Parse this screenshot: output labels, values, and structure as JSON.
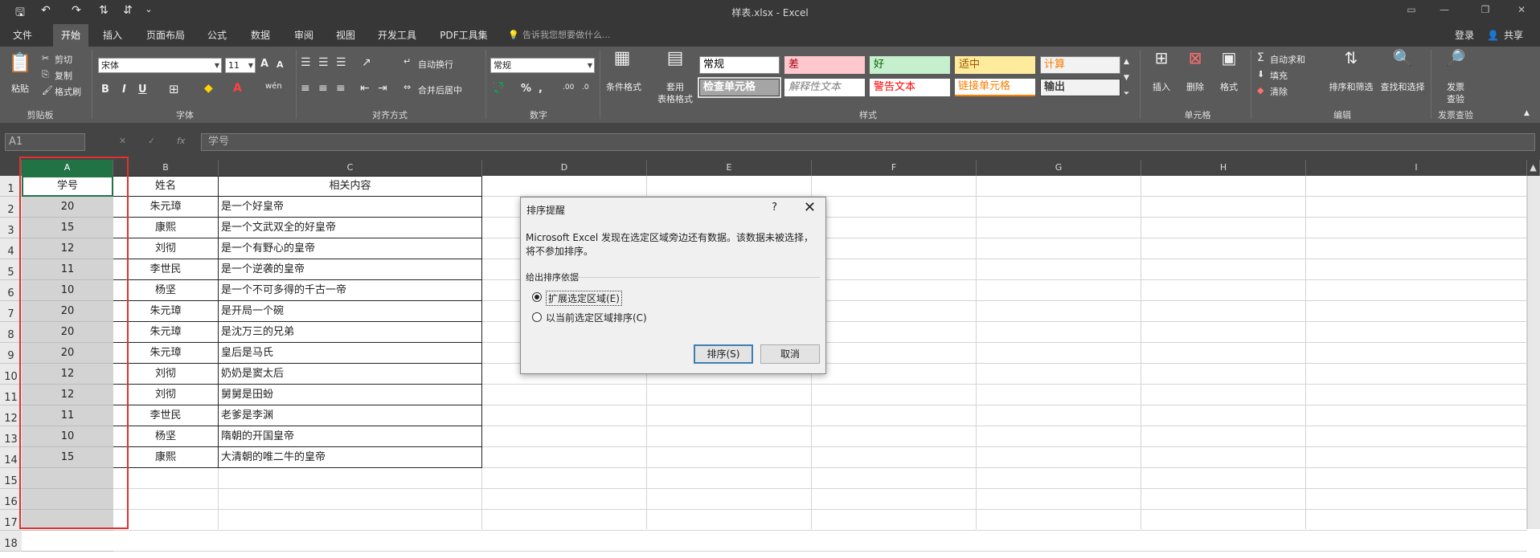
{
  "window": {
    "title": "样表.xlsx - Excel"
  },
  "quick_access": {
    "save": "🖫",
    "undo": "↶",
    "redo": "↷",
    "sort_asc": "⇅",
    "sort_desc": "⇵",
    "customize": "⌄"
  },
  "window_controls": {
    "restore_ribbon": "▭",
    "minimize": "—",
    "maximize": "❐",
    "close": "✕"
  },
  "menu": {
    "tabs": [
      "文件",
      "开始",
      "插入",
      "页面布局",
      "公式",
      "数据",
      "审阅",
      "视图",
      "开发工具",
      "PDF工具集"
    ],
    "active_index": 1,
    "tell_me": "告诉我您想要做什么...",
    "signin": "登录",
    "share": "共享"
  },
  "ribbon": {
    "clipboard": {
      "paste": "粘贴",
      "cut": "剪切",
      "copy": "复制",
      "format_painter": "格式刷",
      "label": "剪贴板"
    },
    "font": {
      "name": "宋体",
      "size": "11",
      "grow": "A",
      "shrink": "A",
      "bold": "B",
      "italic": "I",
      "underline": "U",
      "wen": "wén",
      "label": "字体"
    },
    "alignment": {
      "wrap": "自动换行",
      "merge": "合并后居中",
      "label": "对齐方式"
    },
    "number": {
      "format": "常规",
      "percent": "%",
      "comma": ",",
      "label": "数字"
    },
    "styles": {
      "conditional": "条件格式",
      "table_format": [
        "套用",
        "表格格式"
      ],
      "cells": [
        {
          "text": "常规",
          "bg": "#ffffff",
          "fg": "#000000",
          "border": "#888888"
        },
        {
          "text": "差",
          "bg": "#ffc7ce",
          "fg": "#9c0006",
          "border": "#ffc7ce"
        },
        {
          "text": "好",
          "bg": "#c6efce",
          "fg": "#006100",
          "border": "#c6efce"
        },
        {
          "text": "适中",
          "bg": "#ffeb9c",
          "fg": "#9c5700",
          "border": "#ffeb9c"
        },
        {
          "text": "计算",
          "bg": "#f2f2f2",
          "fg": "#fa7d00",
          "border": "#7f7f7f"
        },
        {
          "text": "检查单元格",
          "bg": "#a5a5a5",
          "fg": "#ffffff",
          "border": "#3f3f3f"
        },
        {
          "text": "解释性文本",
          "bg": "#ffffff",
          "fg": "#7f7f7f",
          "border": "#ffffff"
        },
        {
          "text": "警告文本",
          "bg": "#ffffff",
          "fg": "#ff0000",
          "border": "#ffffff"
        },
        {
          "text": "链接单元格",
          "bg": "#ffffff",
          "fg": "#fa7d00",
          "border": "#ff8001"
        },
        {
          "text": "输出",
          "bg": "#f2f2f2",
          "fg": "#3f3f3f",
          "border": "#3f3f3f"
        }
      ],
      "label": "样式"
    },
    "cells_group": {
      "insert": "插入",
      "delete": "删除",
      "format": "格式",
      "label": "单元格"
    },
    "editing": {
      "autosum": "自动求和",
      "fill": "填充",
      "clear": "清除",
      "sort_filter": "排序和筛选",
      "find_select": "查找和选择",
      "label": "编辑"
    },
    "invoice": {
      "btn": [
        "发票",
        "查验"
      ],
      "label": "发票查验"
    }
  },
  "formula_bar": {
    "name_box": "A1",
    "cancel": "✕",
    "enter": "✓",
    "fx": "fx",
    "content": "学号"
  },
  "sheet": {
    "columns": [
      "A",
      "B",
      "C",
      "D",
      "E",
      "F",
      "G",
      "H",
      "I"
    ],
    "row_numbers": [
      "1",
      "2",
      "3",
      "4",
      "5",
      "6",
      "7",
      "8",
      "9",
      "10",
      "11",
      "12",
      "13",
      "14",
      "15",
      "16",
      "17",
      "18"
    ],
    "header": [
      "学号",
      "姓名",
      "相关内容"
    ],
    "rows": [
      [
        "20",
        "朱元璋",
        "是一个好皇帝"
      ],
      [
        "15",
        "康熙",
        "是一个文武双全的好皇帝"
      ],
      [
        "12",
        "刘彻",
        "是一个有野心的皇帝"
      ],
      [
        "11",
        "李世民",
        "是一个逆袭的皇帝"
      ],
      [
        "10",
        "杨坚",
        "是一个不可多得的千古一帝"
      ],
      [
        "20",
        "朱元璋",
        "是开局一个碗"
      ],
      [
        "20",
        "朱元璋",
        "是沈万三的兄弟"
      ],
      [
        "20",
        "朱元璋",
        "皇后是马氏"
      ],
      [
        "12",
        "刘彻",
        "奶奶是窦太后"
      ],
      [
        "12",
        "刘彻",
        "舅舅是田蚡"
      ],
      [
        "11",
        "李世民",
        "老爹是李渊"
      ],
      [
        "10",
        "杨坚",
        "隋朝的开国皇帝"
      ],
      [
        "15",
        "康熙",
        "大清朝的唯二牛的皇帝"
      ]
    ],
    "highlight_color": "#e03030",
    "selection_color": "#217346"
  },
  "dialog": {
    "title": "排序提醒",
    "help": "?",
    "close": "✕",
    "message": "Microsoft Excel 发现在选定区域旁边还有数据。该数据未被选择，将不参加排序。",
    "section": "给出排序依据",
    "option_expand": "扩展选定区域(E)",
    "option_current": "以当前选定区域排序(C)",
    "selected_option": "expand",
    "ok": "排序(S)",
    "cancel": "取消"
  }
}
